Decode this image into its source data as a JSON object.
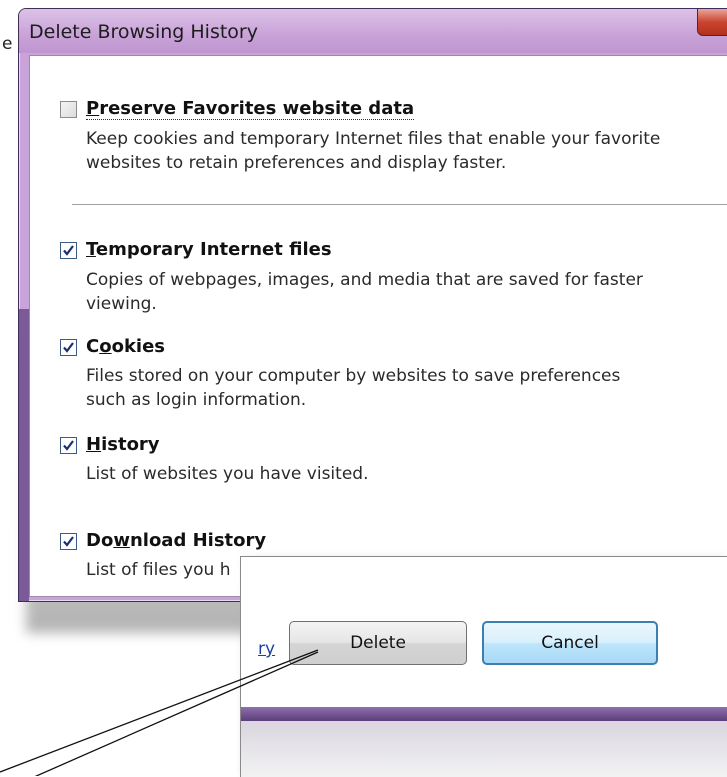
{
  "stray_text": "e",
  "dialog": {
    "title": "Delete Browsing History",
    "options": [
      {
        "label": "Preserve Favorites website data",
        "checked": false,
        "description_lines": [
          "Keep cookies and temporary Internet files that enable your favorite",
          "websites to retain preferences and display faster."
        ]
      },
      {
        "label": "Temporary Internet files",
        "checked": true,
        "description_lines": [
          "Copies of webpages, images, and media that are saved for faster",
          "viewing."
        ]
      },
      {
        "label": "Cookies",
        "checked": true,
        "description_lines": [
          "Files stored on your computer by websites to save preferences",
          "such as login information."
        ]
      },
      {
        "label": "History",
        "checked": true,
        "description_lines": [
          "List of websites you have visited."
        ]
      },
      {
        "label": "Download History",
        "checked": true,
        "description_lines": [
          "List of files you h"
        ]
      }
    ]
  },
  "inset": {
    "link_fragment": "ry",
    "delete_label": "Delete",
    "cancel_label": "Cancel"
  },
  "colors": {
    "frame": "#c9a3d9",
    "close": "#c9452f",
    "link": "#1e3fa8",
    "cancel_border": "#3c7fb1"
  }
}
